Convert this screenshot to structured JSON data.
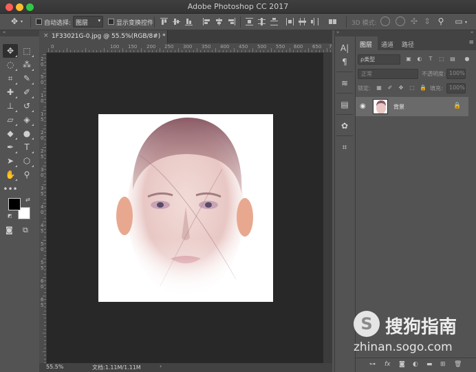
{
  "window": {
    "title": "Adobe Photoshop CC 2017"
  },
  "options_bar": {
    "auto_select_label": "自动选择:",
    "auto_select_target": "图层",
    "show_transform_label": "显示变换控件",
    "mode_3d_label": "3D 模式:"
  },
  "document": {
    "tab_title": "1F33021G-0.jpg @ 55.5%(RGB/8#) *",
    "zoom": "55.5%",
    "doc_info": "文档:1.11M/1.11M"
  },
  "rulers": {
    "horizontal": [
      "0",
      "100",
      "150",
      "200",
      "250",
      "300",
      "350",
      "400",
      "450",
      "500",
      "550",
      "600",
      "650",
      "700"
    ],
    "vertical": [
      "2",
      "0",
      "5",
      "0",
      "1",
      "0",
      "1",
      "5",
      "2",
      "0",
      "2",
      "5",
      "3",
      "0",
      "3",
      "5",
      "4",
      "0",
      "4",
      "5",
      "5",
      "0",
      "5",
      "5",
      "6",
      "0",
      "6",
      "5"
    ]
  },
  "layers_panel": {
    "tabs": [
      "图层",
      "通道",
      "路径"
    ],
    "active_tab": "图层",
    "filter_kind": "ρ类型",
    "blend_mode": "正常",
    "opacity_label": "不透明度:",
    "opacity_value": "100%",
    "lock_label": "锁定:",
    "fill_label": "填充:",
    "fill_value": "100%",
    "layers": [
      {
        "name": "背景",
        "visible": true,
        "locked": true
      }
    ]
  },
  "colors": {
    "foreground": "#000000",
    "background": "#ffffff",
    "accent": "#6a6a6a"
  },
  "watermark": {
    "logo_letter": "S",
    "brand": "搜狗指南",
    "url": "zhinan.sogo.com"
  }
}
